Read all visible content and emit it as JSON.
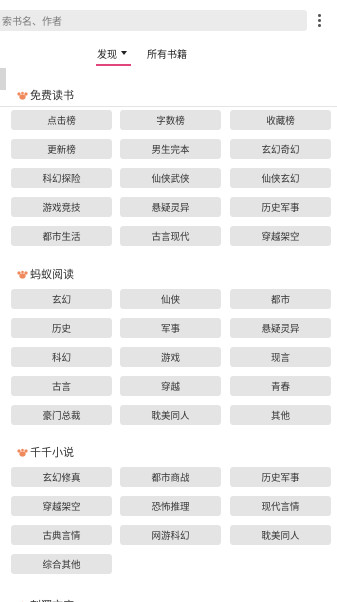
{
  "search": {
    "placeholder": "索书名、作者"
  },
  "tabs": [
    {
      "label": "发现"
    },
    {
      "label": "所有书籍"
    }
  ],
  "sections": [
    {
      "title": "免费读书",
      "items": [
        "点击榜",
        "字数榜",
        "收藏榜",
        "更新榜",
        "男生完本",
        "玄幻奇幻",
        "科幻探险",
        "仙侠武侠",
        "仙侠玄幻",
        "游戏竞技",
        "悬疑灵异",
        "历史军事",
        "都市生活",
        "古言现代",
        "穿越架空"
      ]
    },
    {
      "title": "蚂蚁阅读",
      "items": [
        "玄幻",
        "仙侠",
        "都市",
        "历史",
        "军事",
        "悬疑灵异",
        "科幻",
        "游戏",
        "现言",
        "古言",
        "穿越",
        "青春",
        "豪门总裁",
        "耽美同人",
        "其他"
      ]
    },
    {
      "title": "千千小说",
      "items": [
        "玄幻修真",
        "都市商战",
        "历史军事",
        "穿越架空",
        "恐怖推理",
        "现代言情",
        "古典言情",
        "网游科幻",
        "耽美同人",
        "综合其他"
      ]
    },
    {
      "title": "刺猬文库",
      "items": []
    }
  ],
  "colors": {
    "accent": "#e0457b",
    "section_icon": "#f08a5d",
    "chip_bg": "#e4e4e4"
  },
  "icons": {
    "more": "more-vertical-icon",
    "section": "section-logo-icon"
  }
}
